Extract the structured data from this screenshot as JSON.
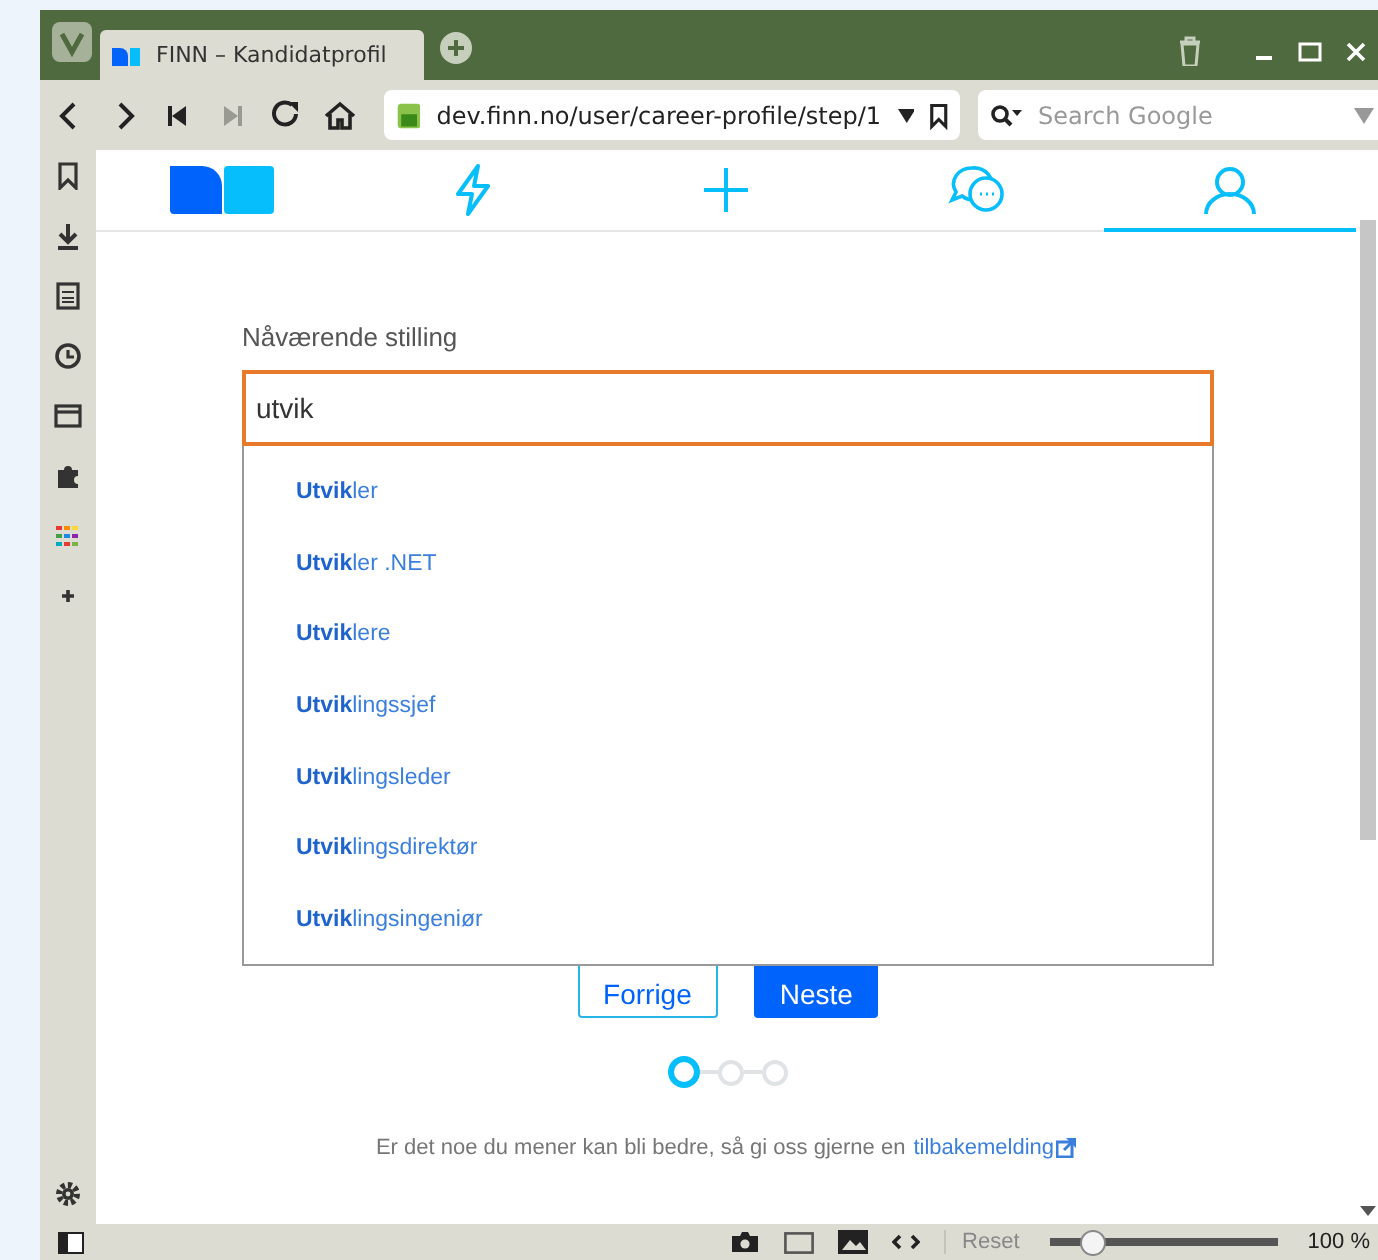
{
  "browser": {
    "tabs": [
      {
        "title": "FINN – Kandidatprofil",
        "selected": true
      }
    ],
    "address": "dev.finn.no/user/career-profile/step/1",
    "search": {
      "placeholder": "Search Google"
    },
    "nav_buttons": [
      {
        "kind": "back",
        "disabled": false
      },
      {
        "kind": "forward",
        "disabled": false
      },
      {
        "kind": "first",
        "disabled": false
      },
      {
        "kind": "last",
        "disabled": true
      },
      {
        "kind": "reload",
        "disabled": false
      },
      {
        "kind": "home",
        "disabled": false
      }
    ]
  },
  "sidebar": {
    "items": [
      {
        "kind": "bookmarks"
      },
      {
        "kind": "downloads"
      },
      {
        "kind": "notes"
      },
      {
        "kind": "history"
      },
      {
        "kind": "window"
      },
      {
        "kind": "extensions"
      },
      {
        "kind": "apps"
      },
      {
        "kind": "add"
      }
    ]
  },
  "page": {
    "nav": [
      {
        "kind": "logo",
        "selected": false
      },
      {
        "kind": "bolt",
        "selected": false
      },
      {
        "kind": "plus",
        "selected": false
      },
      {
        "kind": "chat",
        "selected": false
      },
      {
        "kind": "user",
        "selected": true
      }
    ],
    "field": {
      "label": "Nåværende stilling",
      "value": "utvik"
    },
    "suggestions": [
      {
        "text": "**Utvik**ler"
      },
      {
        "text": "**Utvik**ler .NET"
      },
      {
        "text": "**Utvik**lere"
      },
      {
        "text": "**Utvik**lingssjef"
      },
      {
        "text": "**Utvik**lingsleder"
      },
      {
        "text": "**Utvik**lingsdirektør"
      },
      {
        "text": "**Utvik**lingsingeniør"
      }
    ],
    "buttons": [
      {
        "label": "Forrige",
        "kind": "secondary"
      },
      {
        "label": "Neste",
        "kind": "primary"
      }
    ],
    "steps": [
      {
        "selected": true
      },
      {
        "selected": false
      },
      {
        "selected": false
      }
    ],
    "feedback": {
      "text": "Er det noe du mener kan bli bedre, så gi oss gjerne en",
      "link": "tilbakemelding"
    }
  },
  "status_bar": {
    "reset": "Reset",
    "zoom": {
      "level": 0.19
    },
    "zoom_text": "100 %"
  }
}
